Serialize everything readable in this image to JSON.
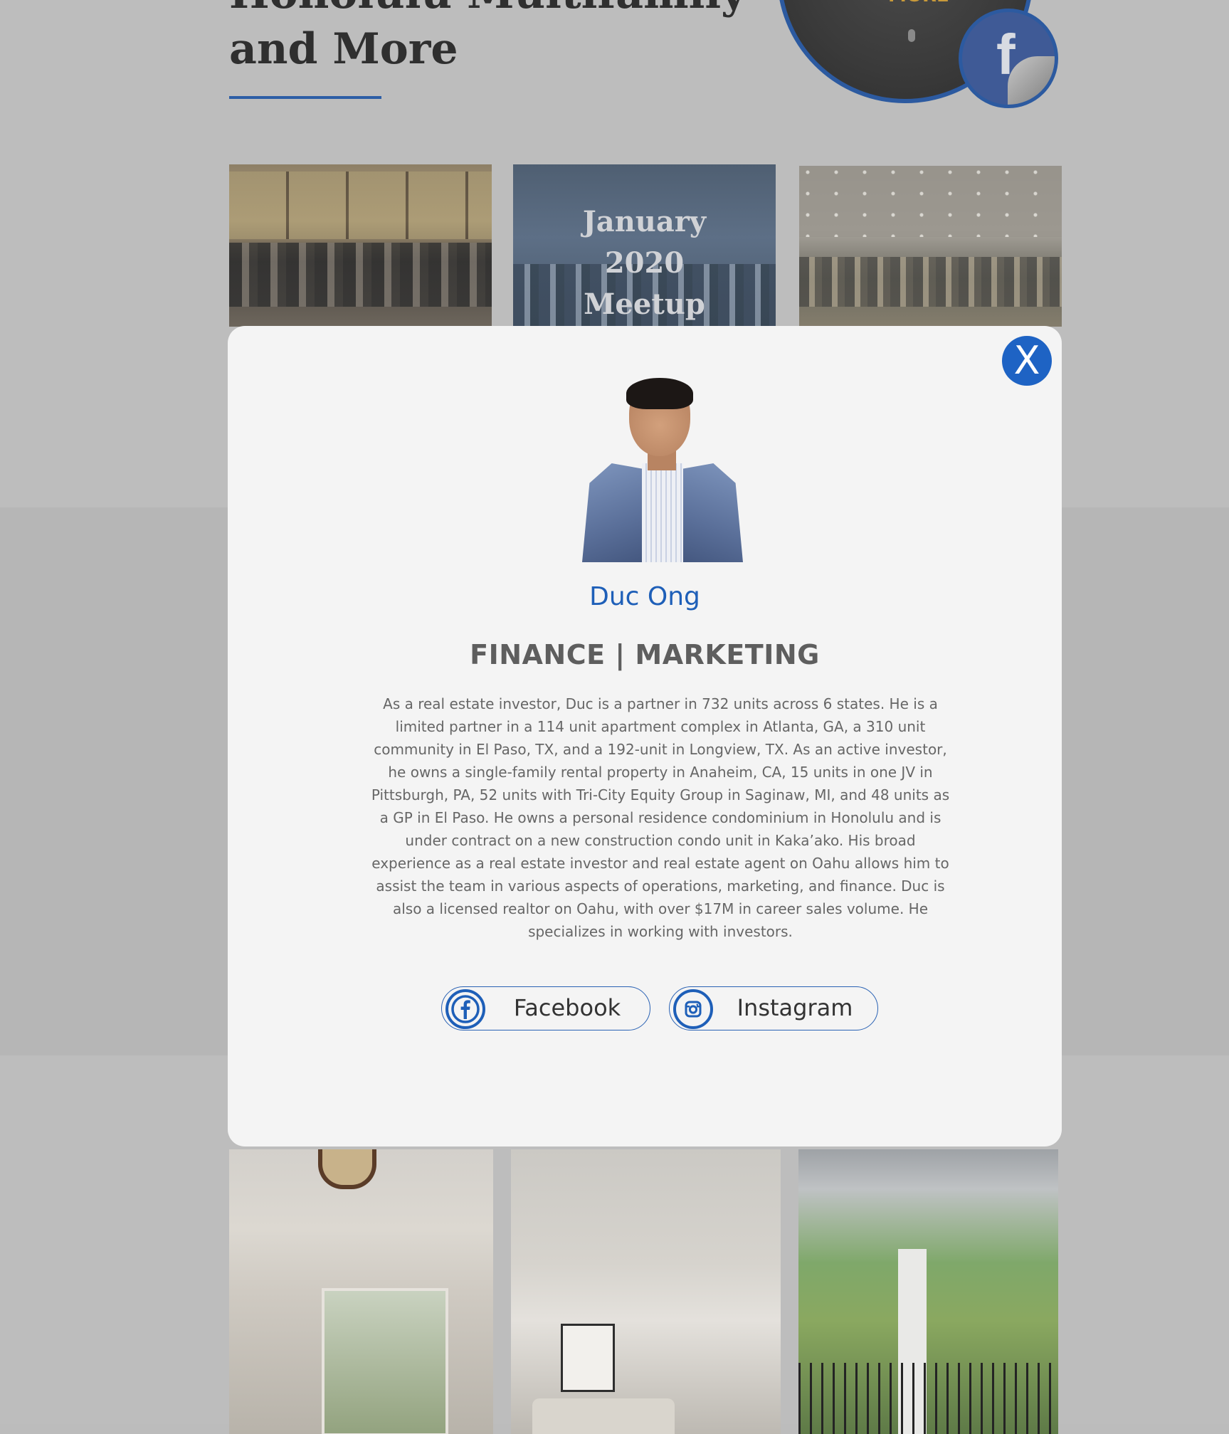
{
  "header": {
    "title_line1": "Honolulu Multifamily",
    "title_line2": "and More"
  },
  "podcast": {
    "cover_text": "MORE"
  },
  "gallery": {
    "meetup_caption_line1": "January",
    "meetup_caption_line2": "2020",
    "meetup_caption_line3": "Meetup"
  },
  "modal": {
    "close_label": "X",
    "name": "Duc Ong",
    "role": "FINANCE | MARKETING",
    "bio": "As a real estate investor, Duc is a partner in 732 units across 6 states. He is a limited partner in a 114 unit apartment complex in Atlanta, GA, a 310 unit community in El Paso, TX, and a 192-unit in Longview, TX. As an active investor, he owns a single-family rental property in Anaheim, CA, 15 units in one JV in Pittsburgh, PA, 52 units with Tri-City Equity Group in Saginaw, MI, and 48 units as a GP in El Paso. He owns a personal residence condominium in Honolulu and is under contract on a new construction condo unit in Kaka’ako. His broad experience as a real estate investor and real estate agent  on Oahu allows him to assist the team in various aspects of operations, marketing, and finance. Duc is also a licensed realtor on Oahu, with over $17M in career sales volume. He specializes in working with investors.",
    "social": {
      "facebook_label": "Facebook",
      "instagram_label": "Instagram"
    }
  },
  "colors": {
    "accent": "#1e63c4",
    "name_blue": "#1e5fb8",
    "overlay_gray": "#bdbdbd",
    "modal_bg": "#f4f4f4"
  },
  "icons": [
    "facebook-icon",
    "instagram-icon",
    "close-icon",
    "facebook-badge-icon"
  ]
}
